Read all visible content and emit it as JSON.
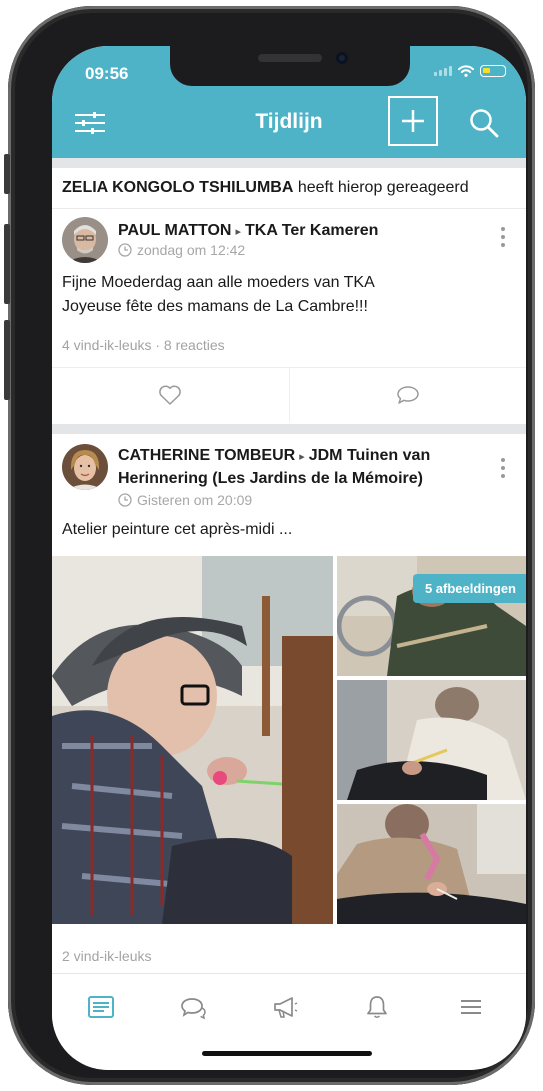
{
  "status_bar": {
    "time": "09:56"
  },
  "app_bar": {
    "title": "Tijdlijn"
  },
  "feed": {
    "reaction_notice": {
      "name": "ZELIA KONGOLO TSHILUMBA",
      "text": "heeft hierop gereageerd"
    },
    "posts": [
      {
        "author": "PAUL MATTON",
        "group": "TKA Ter Kameren",
        "time": "zondag om 12:42",
        "lines": [
          "Fijne Moederdag aan alle moeders van TKA",
          "Joyeuse fête des mamans de La Cambre!!!"
        ],
        "stats": "4 vind-ik-leuks · 8 reacties"
      },
      {
        "author": "CATHERINE TOMBEUR",
        "group_line1": "JDM Tuinen van",
        "group_line2": "Herinnering (Les Jardins de la Mémoire)",
        "time": "Gisteren om 20:09",
        "text": "Atelier peinture cet après-midi ...",
        "image_count_badge": "5 afbeeldingen",
        "stats": "2 vind-ik-leuks"
      }
    ]
  },
  "tab_bar": {
    "tabs": [
      "timeline-icon",
      "chat-icon",
      "megaphone-icon",
      "bell-icon",
      "menu-icon"
    ],
    "active_color": "#4fb3c8",
    "inactive_color": "#8a8a8a"
  },
  "colors": {
    "accent": "#4fb3c8",
    "divider": "#e4e5e7",
    "muted_text": "#a7a7a7"
  }
}
